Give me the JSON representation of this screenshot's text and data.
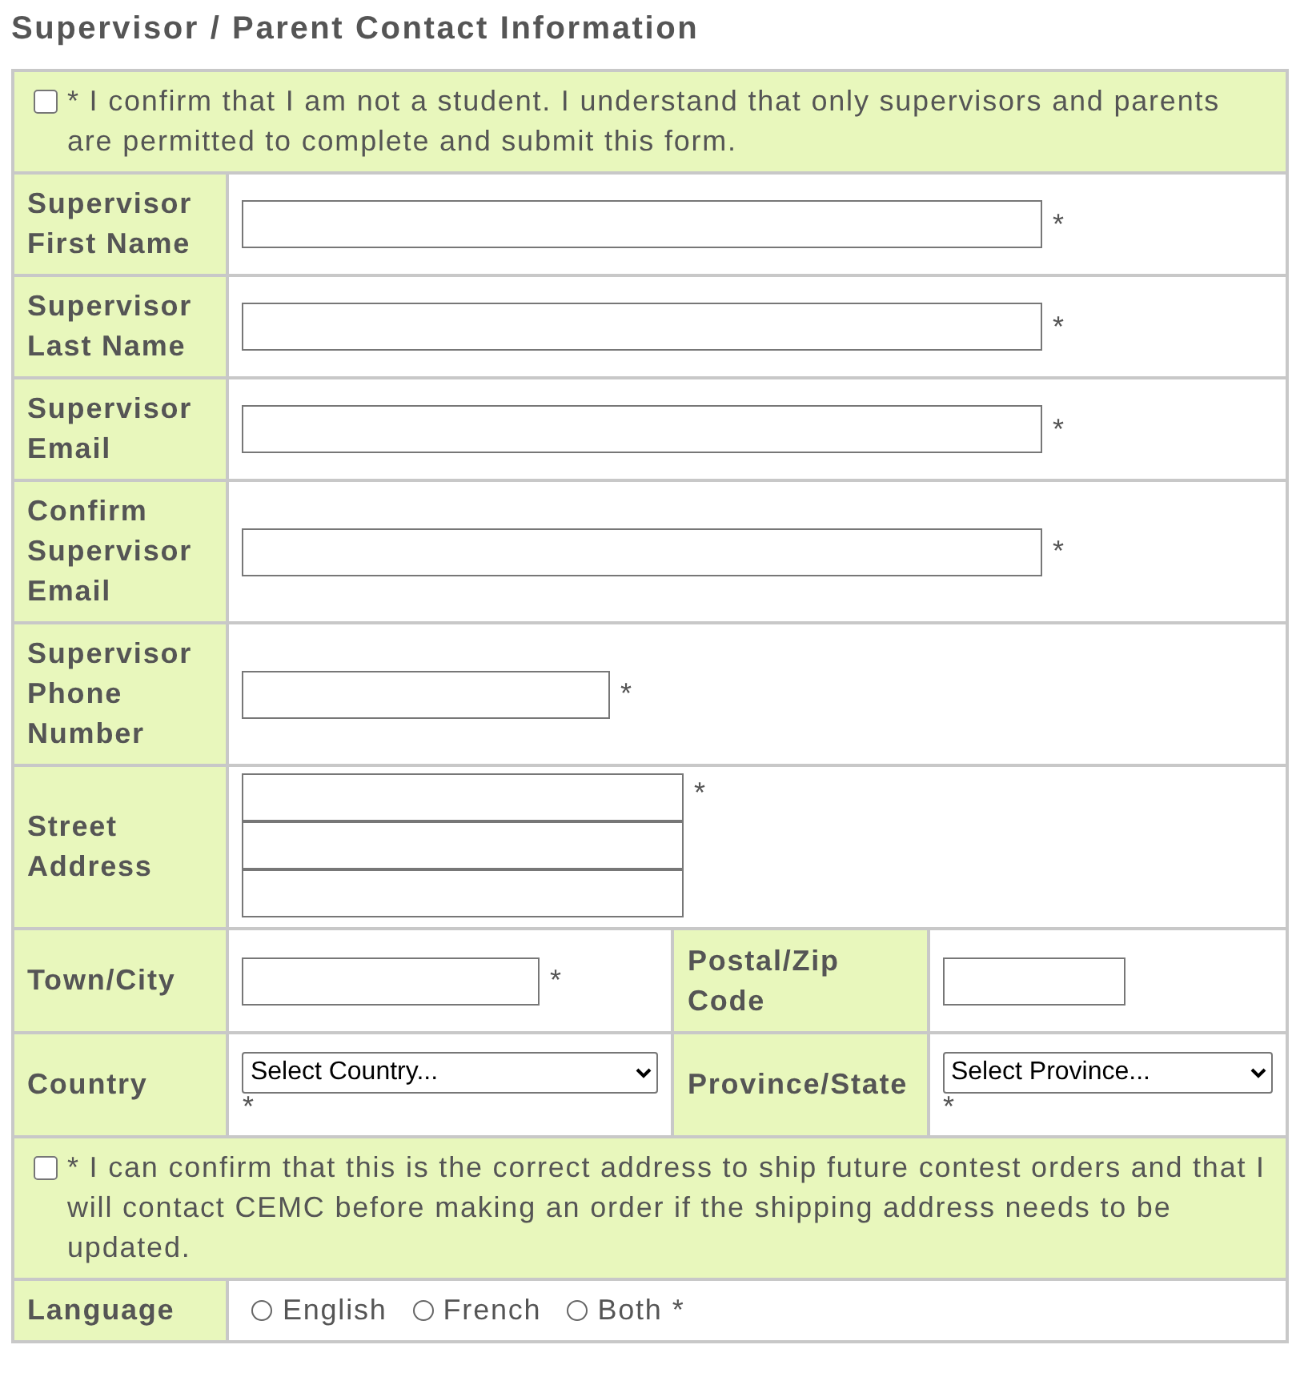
{
  "title": "Supervisor / Parent Contact Information",
  "rows": [
    {
      "kind": "check",
      "checked": false,
      "text": "* I confirm that I am not a student. I understand that only supervisors and parents are permitted to complete and submit this form."
    },
    {
      "kind": "input",
      "label": "Supervisor First Name",
      "input": {
        "kind": "long"
      },
      "mark": "*"
    },
    {
      "kind": "input",
      "label": "Supervisor Last Name",
      "input": {
        "kind": "long"
      },
      "mark": "*"
    },
    {
      "kind": "input",
      "label": "Supervisor Email",
      "input": {
        "kind": "long"
      },
      "mark": "*"
    },
    {
      "kind": "input",
      "label": "Confirm Supervisor Email",
      "input": {
        "kind": "long"
      },
      "mark": "*"
    },
    {
      "kind": "input",
      "label": "Supervisor Phone Number",
      "input": {
        "kind": "phone"
      },
      "mark": "*"
    },
    {
      "kind": "address",
      "label": "Street Address",
      "mark": "*"
    },
    {
      "kind": "split",
      "cells": [
        {
          "label": "Town/City",
          "input": {
            "kind": "town"
          },
          "mark": "*"
        },
        {
          "label": "Postal/Zip Code",
          "input": {
            "kind": "postal"
          }
        }
      ]
    },
    {
      "kind": "split",
      "cells": [
        {
          "label": "Country",
          "input": {
            "kind": "select",
            "value": "Select Country..."
          },
          "mark": "*"
        },
        {
          "label": "Province/State",
          "input": {
            "kind": "select",
            "value": "Select Province..."
          },
          "mark": "*"
        }
      ]
    },
    {
      "kind": "check",
      "checked": false,
      "text": "* I can confirm that this is the correct address to ship future contest orders and that I will contact CEMC before making an order if the shipping address needs to be updated."
    },
    {
      "kind": "radios",
      "label": "Language",
      "mark": "*",
      "options": [
        {
          "label": "English",
          "selected": false
        },
        {
          "label": "French",
          "selected": false
        },
        {
          "label": "Both",
          "selected": false
        }
      ]
    }
  ]
}
